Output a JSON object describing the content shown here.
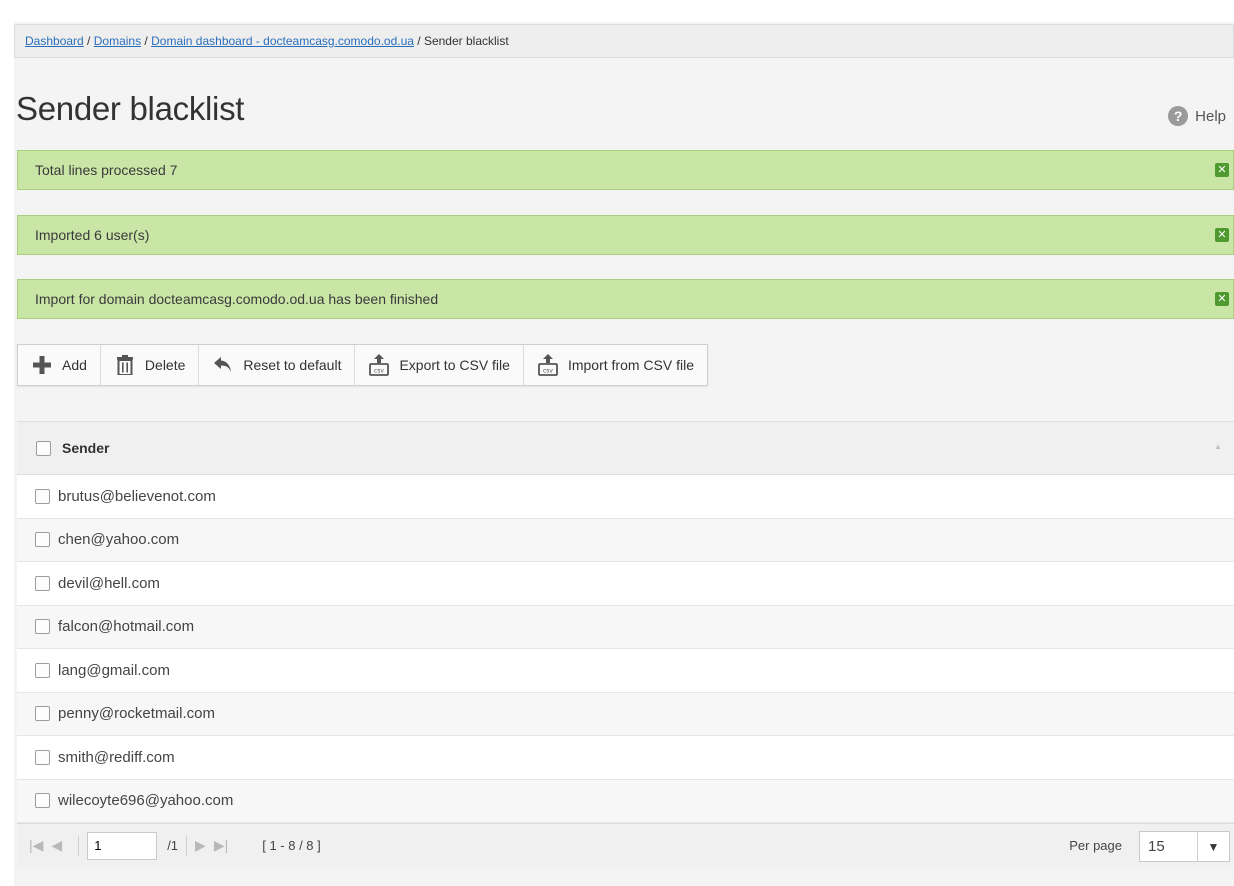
{
  "breadcrumb": {
    "items": [
      "Dashboard",
      "Domains",
      "Domain dashboard - docteamcasg.comodo.od.ua"
    ],
    "separator": " / ",
    "current": "Sender blacklist"
  },
  "page_title": "Sender blacklist",
  "help_label": "Help",
  "alerts": [
    "Total lines processed 7",
    "Imported 6 user(s)",
    "Import for domain docteamcasg.comodo.od.ua has been finished"
  ],
  "toolbar": {
    "add_label": "Add",
    "delete_label": "Delete",
    "reset_label": "Reset to default",
    "export_label": "Export to CSV file",
    "import_label": "Import from CSV file"
  },
  "table": {
    "column_header": "Sender",
    "rows": [
      "brutus@believenot.com",
      "chen@yahoo.com",
      "devil@hell.com",
      "falcon@hotmail.com",
      "lang@gmail.com",
      "penny@rocketmail.com",
      "smith@rediff.com",
      "wilecoyte696@yahoo.com"
    ]
  },
  "pager": {
    "current_page": "1",
    "total_pages": "/1",
    "range": "[ 1 - 8 / 8 ]",
    "per_page_label": "Per page",
    "per_page_value": "15"
  },
  "colors": {
    "alert_bg": "#c9e6a7",
    "alert_close": "#4f9a2e",
    "link": "#2a6ebb"
  }
}
